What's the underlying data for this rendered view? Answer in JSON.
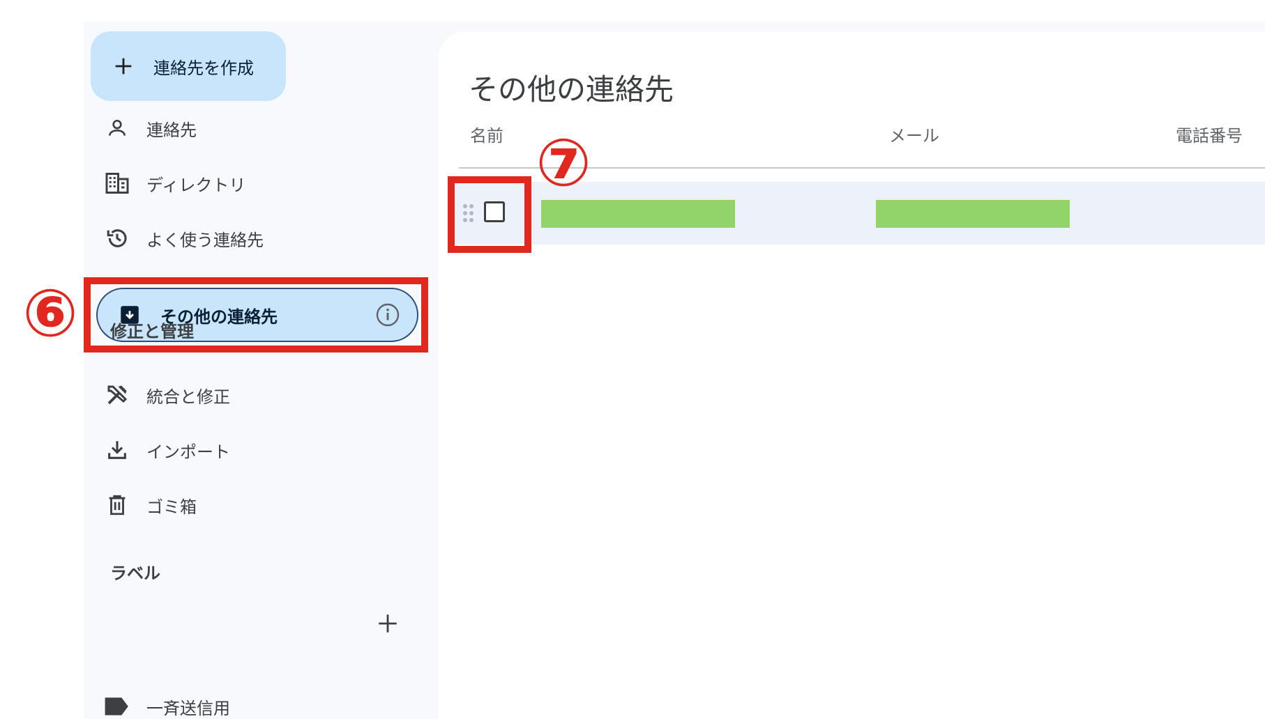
{
  "sidebar": {
    "create_button": {
      "label": "連絡先を作成",
      "icon": "plus-icon"
    },
    "items": [
      {
        "label": "連絡先",
        "icon": "person-icon"
      },
      {
        "label": "ディレクトリ",
        "icon": "building-icon"
      },
      {
        "label": "よく使う連絡先",
        "icon": "history-icon"
      },
      {
        "label": "その他の連絡先",
        "icon": "archive-download-icon",
        "active": true,
        "info_icon": "info-icon"
      }
    ],
    "section_manage": {
      "title": "修正と管理",
      "items": [
        {
          "label": "統合と修正",
          "icon": "tools-icon"
        },
        {
          "label": "インポート",
          "icon": "download-icon"
        },
        {
          "label": "ゴミ箱",
          "icon": "trash-icon"
        }
      ]
    },
    "section_labels": {
      "title": "ラベル",
      "add_icon": "plus-icon",
      "items": [
        {
          "label": "一斉送信用",
          "icon": "label-icon"
        }
      ]
    }
  },
  "main": {
    "title": "その他の連絡先",
    "columns": {
      "name": "名前",
      "email": "メール",
      "phone": "電話番号"
    }
  },
  "annotations": {
    "step6": "⑥",
    "step7": "⑦",
    "color": "#e0281f"
  },
  "colors": {
    "accent": "#c8e5fb",
    "redaction": "#92d46a",
    "row_highlight": "#edf2fa"
  }
}
